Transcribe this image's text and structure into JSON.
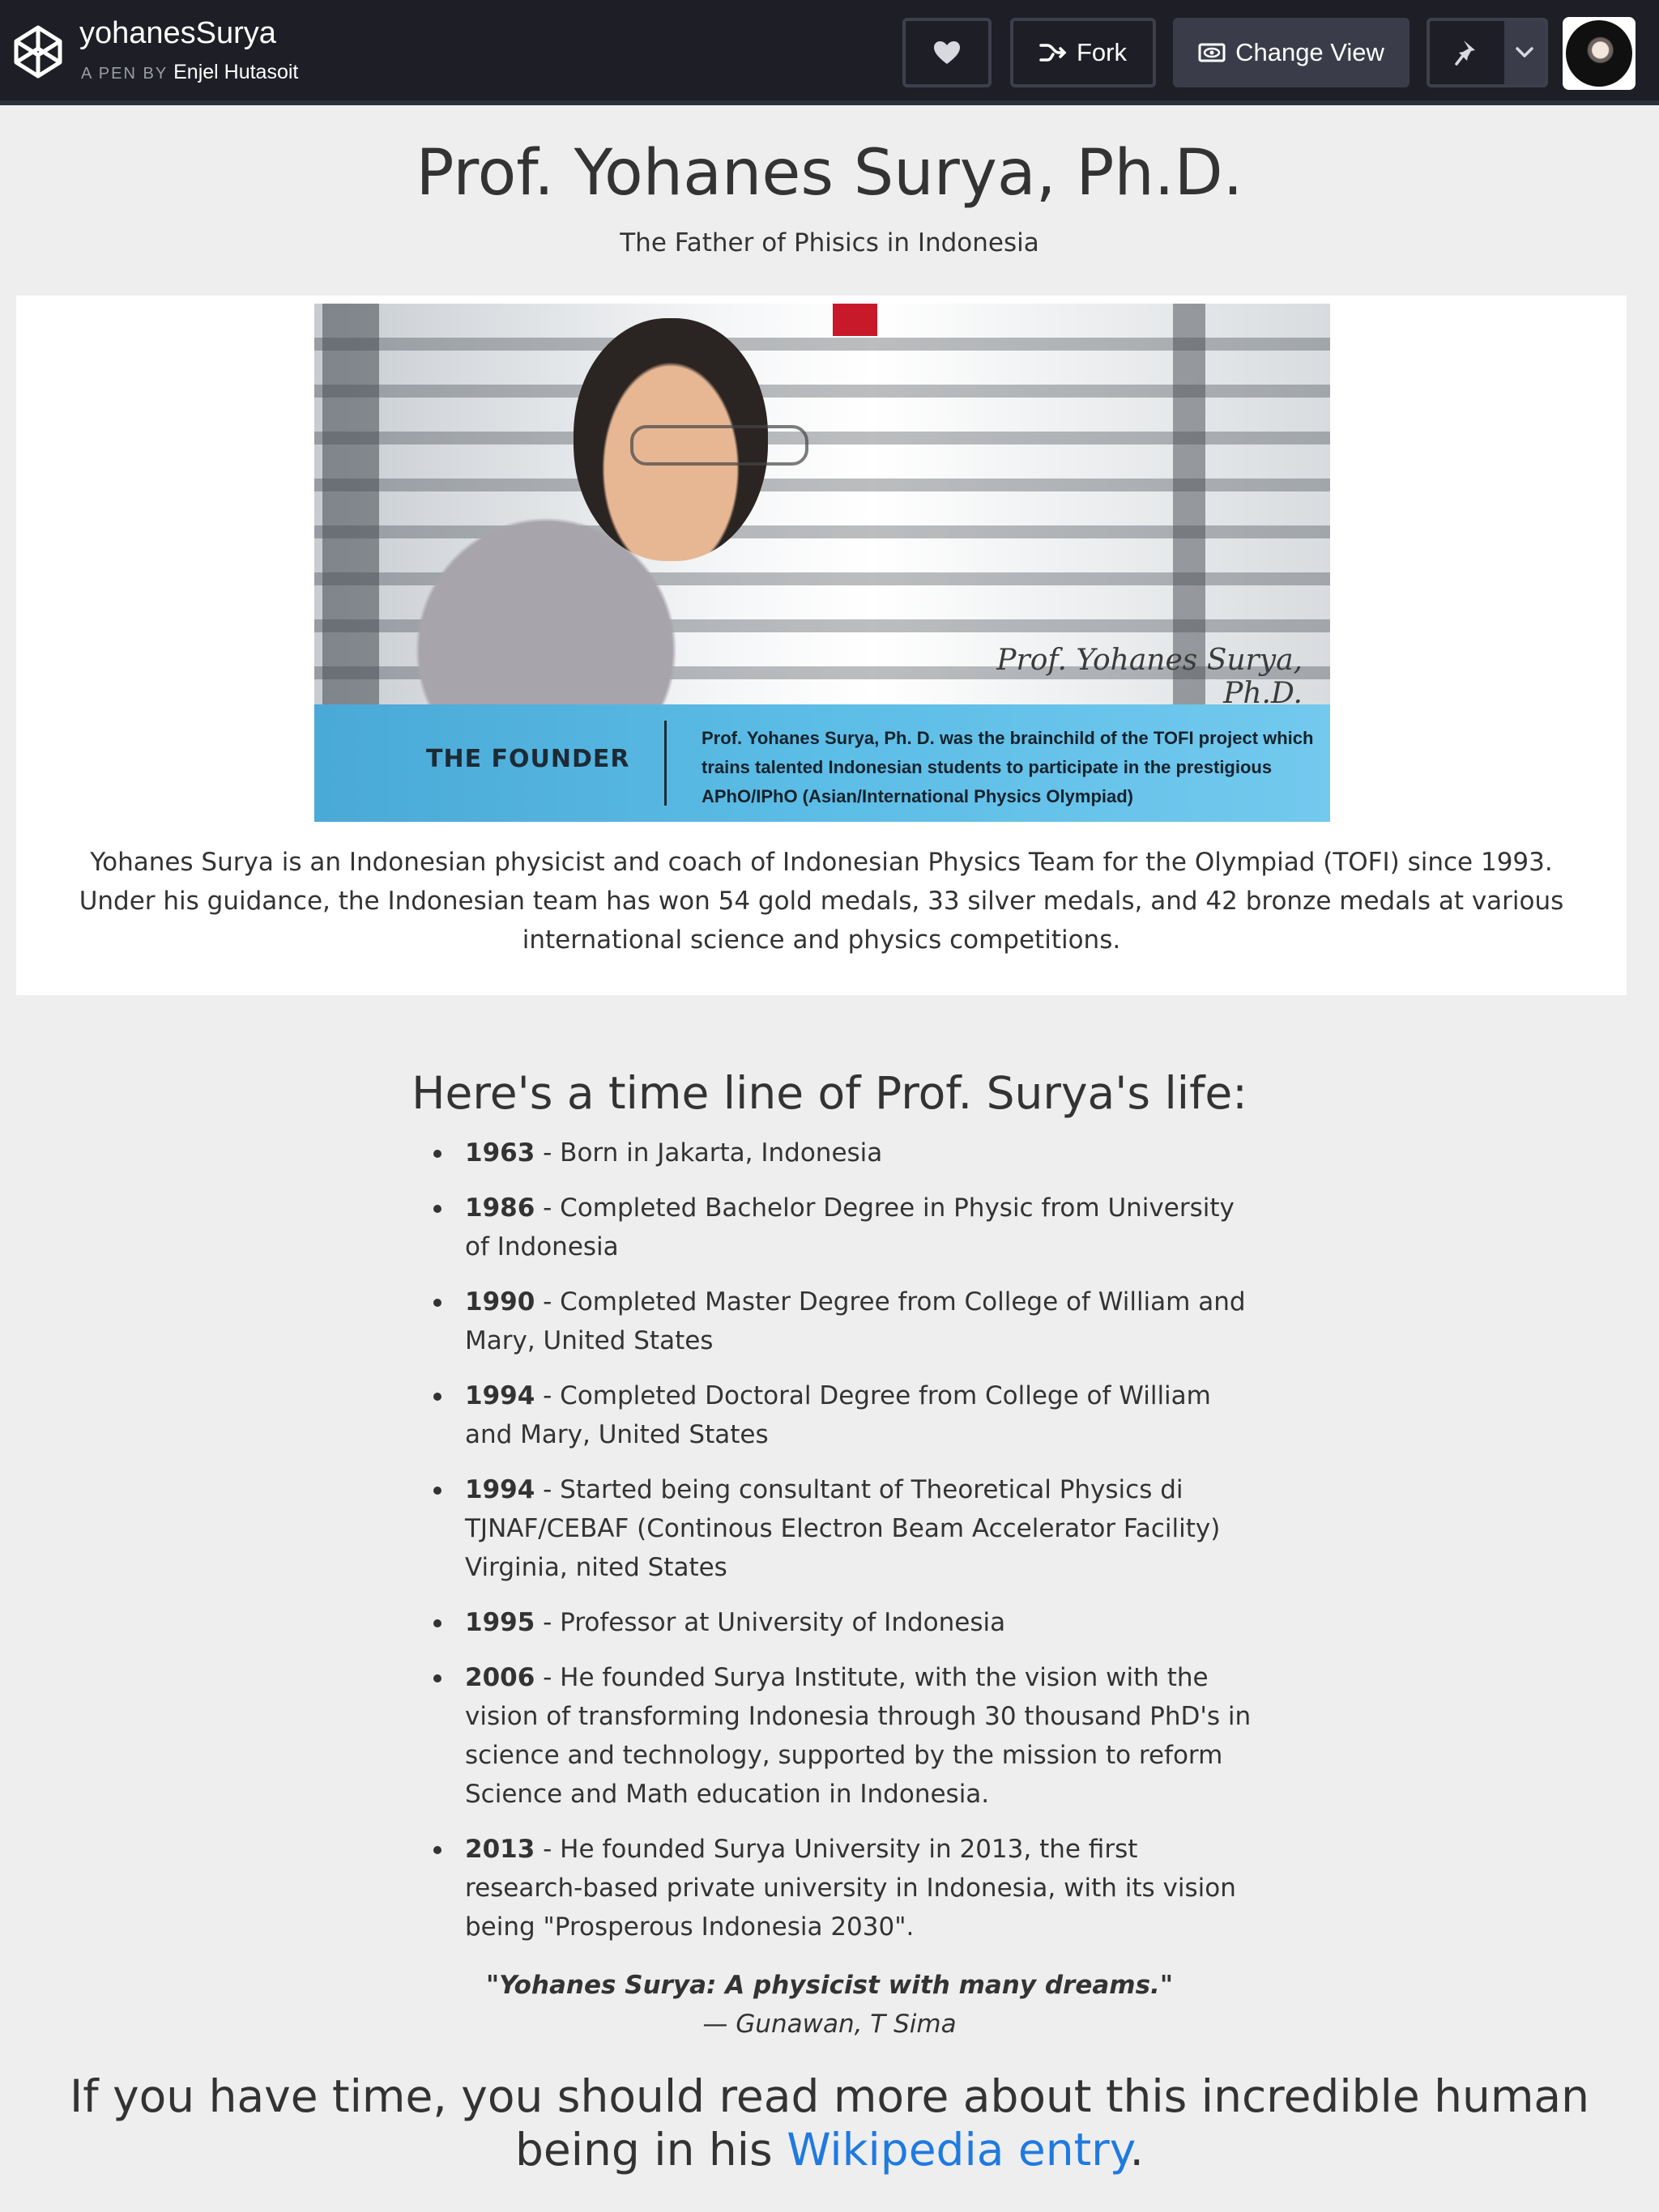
{
  "topbar": {
    "pen_title": "yohanesSurya",
    "pen_by_prefix": "A PEN BY",
    "author": "Enjel Hutasoit",
    "fork_label": "Fork",
    "change_view_label": "Change View",
    "icons": [
      "codepen-logo-icon",
      "heart-icon",
      "fork-icon",
      "eye-icon",
      "pin-icon",
      "chevron-down-icon"
    ]
  },
  "header": {
    "title": "Prof. Yohanes Surya, Ph.D.",
    "subtitle": "The Father of Phisics in Indonesia"
  },
  "image": {
    "overlay_name": "Prof. Yohanes Surya, Ph.D.",
    "band_heading": "THE FOUNDER",
    "band_text": "Prof. Yohanes Surya, Ph. D. was the brainchild of the TOFI project which trains talented Indonesian students to participate in the prestigious APhO/IPhO (Asian/International Physics Olympiad)",
    "caption": "Yohanes Surya is an Indonesian physicist and coach of Indonesian Physics Team for the Olympiad (TOFI) since 1993. Under his guidance, the Indonesian team has won 54 gold medals, 33 silver medals, and 42 bronze medals at various international science and physics competitions."
  },
  "timeline": {
    "heading": "Here's a time line of Prof. Surya's life:",
    "items": [
      {
        "year": "1963",
        "text": " - Born in Jakarta, Indonesia"
      },
      {
        "year": "1986",
        "text": " - Completed Bachelor Degree in Physic from University of Indonesia"
      },
      {
        "year": "1990",
        "text": " - Completed Master Degree from College of William and Mary, United States"
      },
      {
        "year": "1994",
        "text": " - Completed Doctoral Degree from College of William and Mary, United States"
      },
      {
        "year": "1994",
        "text": " - Started being consultant of Theoretical Physics di TJNAF/CEBAF (Continous Electron Beam Accelerator Facility) Virginia, nited States"
      },
      {
        "year": "1995",
        "text": " - Professor at University of Indonesia"
      },
      {
        "year": "2006",
        "text": " - He founded Surya Institute, with the vision with the vision of transforming Indonesia through 30 thousand PhD's in science and technology, supported by the mission to reform Science and Math education in Indonesia."
      },
      {
        "year": "2013",
        "text": " - He founded Surya University in 2013, the first research-based private university in Indonesia, with its vision being \"Prosperous Indonesia 2030\"."
      }
    ]
  },
  "quote": {
    "text": "\"Yohanes Surya: A physicist with many dreams.\"",
    "author": "— Gunawan, T Sima"
  },
  "footer": {
    "text_before": "If you have time, you should read more about this incredible human being in his ",
    "link_text": "Wikipedia entry",
    "text_after": "."
  },
  "colors": {
    "topbar_bg": "#1e1f26",
    "page_bg": "#eeeeee",
    "link": "#1f7ae0",
    "band": "#5cbde6"
  }
}
